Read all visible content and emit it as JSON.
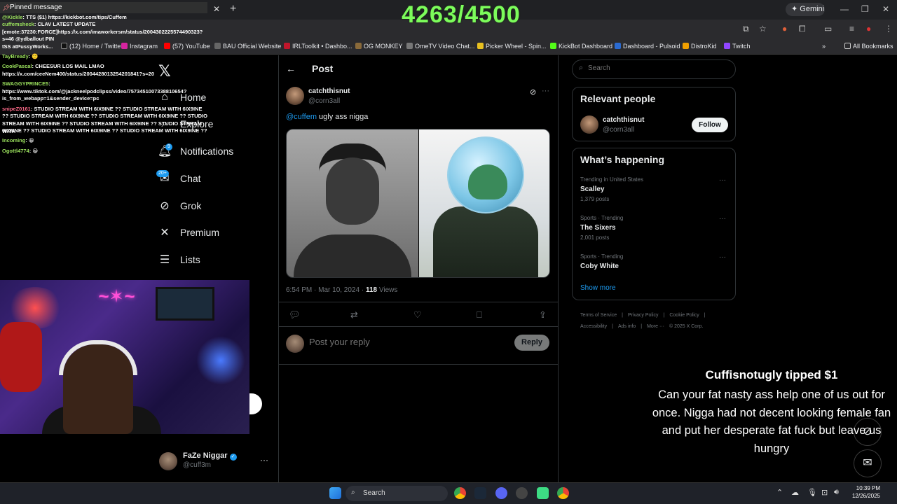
{
  "browser": {
    "gemini_label": "Gemini",
    "bookmarks": [
      "(12) Home / Twitter",
      "Instagram",
      "(57) YouTube",
      "BAU Official Website",
      "IRLToolkit • Dashbo...",
      "OG MONKEY",
      "OmeTV Video Chat...",
      "Picker Wheel - Spin...",
      "KickBot Dashboard",
      "Dashboard - Pulsoid",
      "DistroKid",
      "Twitch"
    ],
    "all_bookmarks": "All Bookmarks"
  },
  "overlay": {
    "counter": "4263/4500",
    "pinned_title": "Pinned message",
    "chat": [
      {
        "name": "@Kickle",
        "text": ": TTS ($1) https://kickbot.com/tips/Cuffem"
      },
      {
        "name": "cuffemsheck",
        "text": ":  CLAV LATEST UPDATE"
      },
      {
        "name": "",
        "text": "[emote:37230:FORCE]https://x.com/imaworkersm/status/2004302225574490323?"
      },
      {
        "name": "",
        "text": "s=46 @ydballout PIN"
      },
      {
        "name": "",
        "text": "tSS  atPussyWorks..."
      },
      {
        "name": "TayBready",
        "text": ": 🙂"
      },
      {
        "name": "CookPascal",
        "text": ":  CHEESUR LOS MAIL LMAO"
      },
      {
        "name": "",
        "text": "https://x.com/ceeNem400/status/2004428013254201841?s=20"
      },
      {
        "name": "SWAGGYPRINCE5",
        "text": ":"
      },
      {
        "name": "",
        "text": "https://www.tiktok.com/@jackneelpodclipss/video/7573451007338810654?"
      },
      {
        "name": "",
        "text": "is_from_webapp=1&sender_device=pc"
      },
      {
        "name": "snipeZ0161",
        "text": ":  STUDIO STREAM WITH 6IX9INE ?? STUDIO STREAM WITH 6IX9INE"
      },
      {
        "name": "",
        "text": "?? STUDIO STREAM WITH 6IX9INE ?? STUDIO STREAM WITH 6IX9INE ?? STUDIO"
      },
      {
        "name": "",
        "text": "STREAM WITH 6IX9INE ?? STUDIO STREAM WITH 6IX9INE ?? STUDIO STREAM WITH"
      },
      {
        "name": "",
        "text": "6IX9INE ?? STUDIO STREAM WITH 6IX9INE ?? STUDIO STREAM WITH 6IX9INE ??"
      },
      {
        "name": "Incoming",
        "text": ": 😀"
      },
      {
        "name": "Ogottl4774",
        "text": ": 😀"
      }
    ],
    "tip_title": "Cuffisnotugly tipped $1",
    "tip_message": "Can your fat nasty ass help one of us out for once. Nigga had not decent looking female fan and put her desperate fat fuck but leave us hungry"
  },
  "nav": {
    "items": [
      {
        "label": "Home",
        "icon": "home-icon"
      },
      {
        "label": "Explore",
        "icon": "search-icon"
      },
      {
        "label": "Notifications",
        "icon": "bell-icon",
        "badge": "9"
      },
      {
        "label": "Chat",
        "icon": "mail-icon",
        "badge": "20+"
      },
      {
        "label": "Grok",
        "icon": "grok-icon"
      },
      {
        "label": "Premium",
        "icon": "x-icon"
      },
      {
        "label": "Lists",
        "icon": "list-icon"
      }
    ]
  },
  "account": {
    "name": "FaZe Niggar",
    "handle": "@cuff3m"
  },
  "post": {
    "header": "Post",
    "author_name": "catchthisnut",
    "author_handle": "@corn3all",
    "mention": "@cuffem",
    "text": " ugly ass nigga",
    "time": "6:54 PM · Mar 10, 2024 · ",
    "views_count": "118",
    "views_label": " Views",
    "reply_placeholder": "Post your reply",
    "reply_button": "Reply"
  },
  "sidebar": {
    "search_placeholder": "Search",
    "relevant_title": "Relevant people",
    "person_name": "catchthisnut",
    "person_handle": "@corn3all",
    "follow_label": "Follow",
    "happening_title": "What’s happening",
    "trends": [
      {
        "context": "Trending in United States",
        "name": "Scalley",
        "count": "1,379 posts"
      },
      {
        "context": "Sports · Trending",
        "name": "The Sixers",
        "count": "2,001 posts"
      },
      {
        "context": "Sports · Trending",
        "name": "Coby White",
        "count": ""
      }
    ],
    "show_more": "Show more",
    "footer": [
      "Terms of Service",
      "|",
      "Privacy Policy",
      "|",
      "Cookie Policy",
      "|",
      "Accessibility",
      "|",
      "Ads info",
      "|",
      "More ···",
      "© 2025 X Corp."
    ]
  },
  "taskbar": {
    "search": "Search",
    "time": "10:39 PM",
    "date": "12/26/2025"
  }
}
